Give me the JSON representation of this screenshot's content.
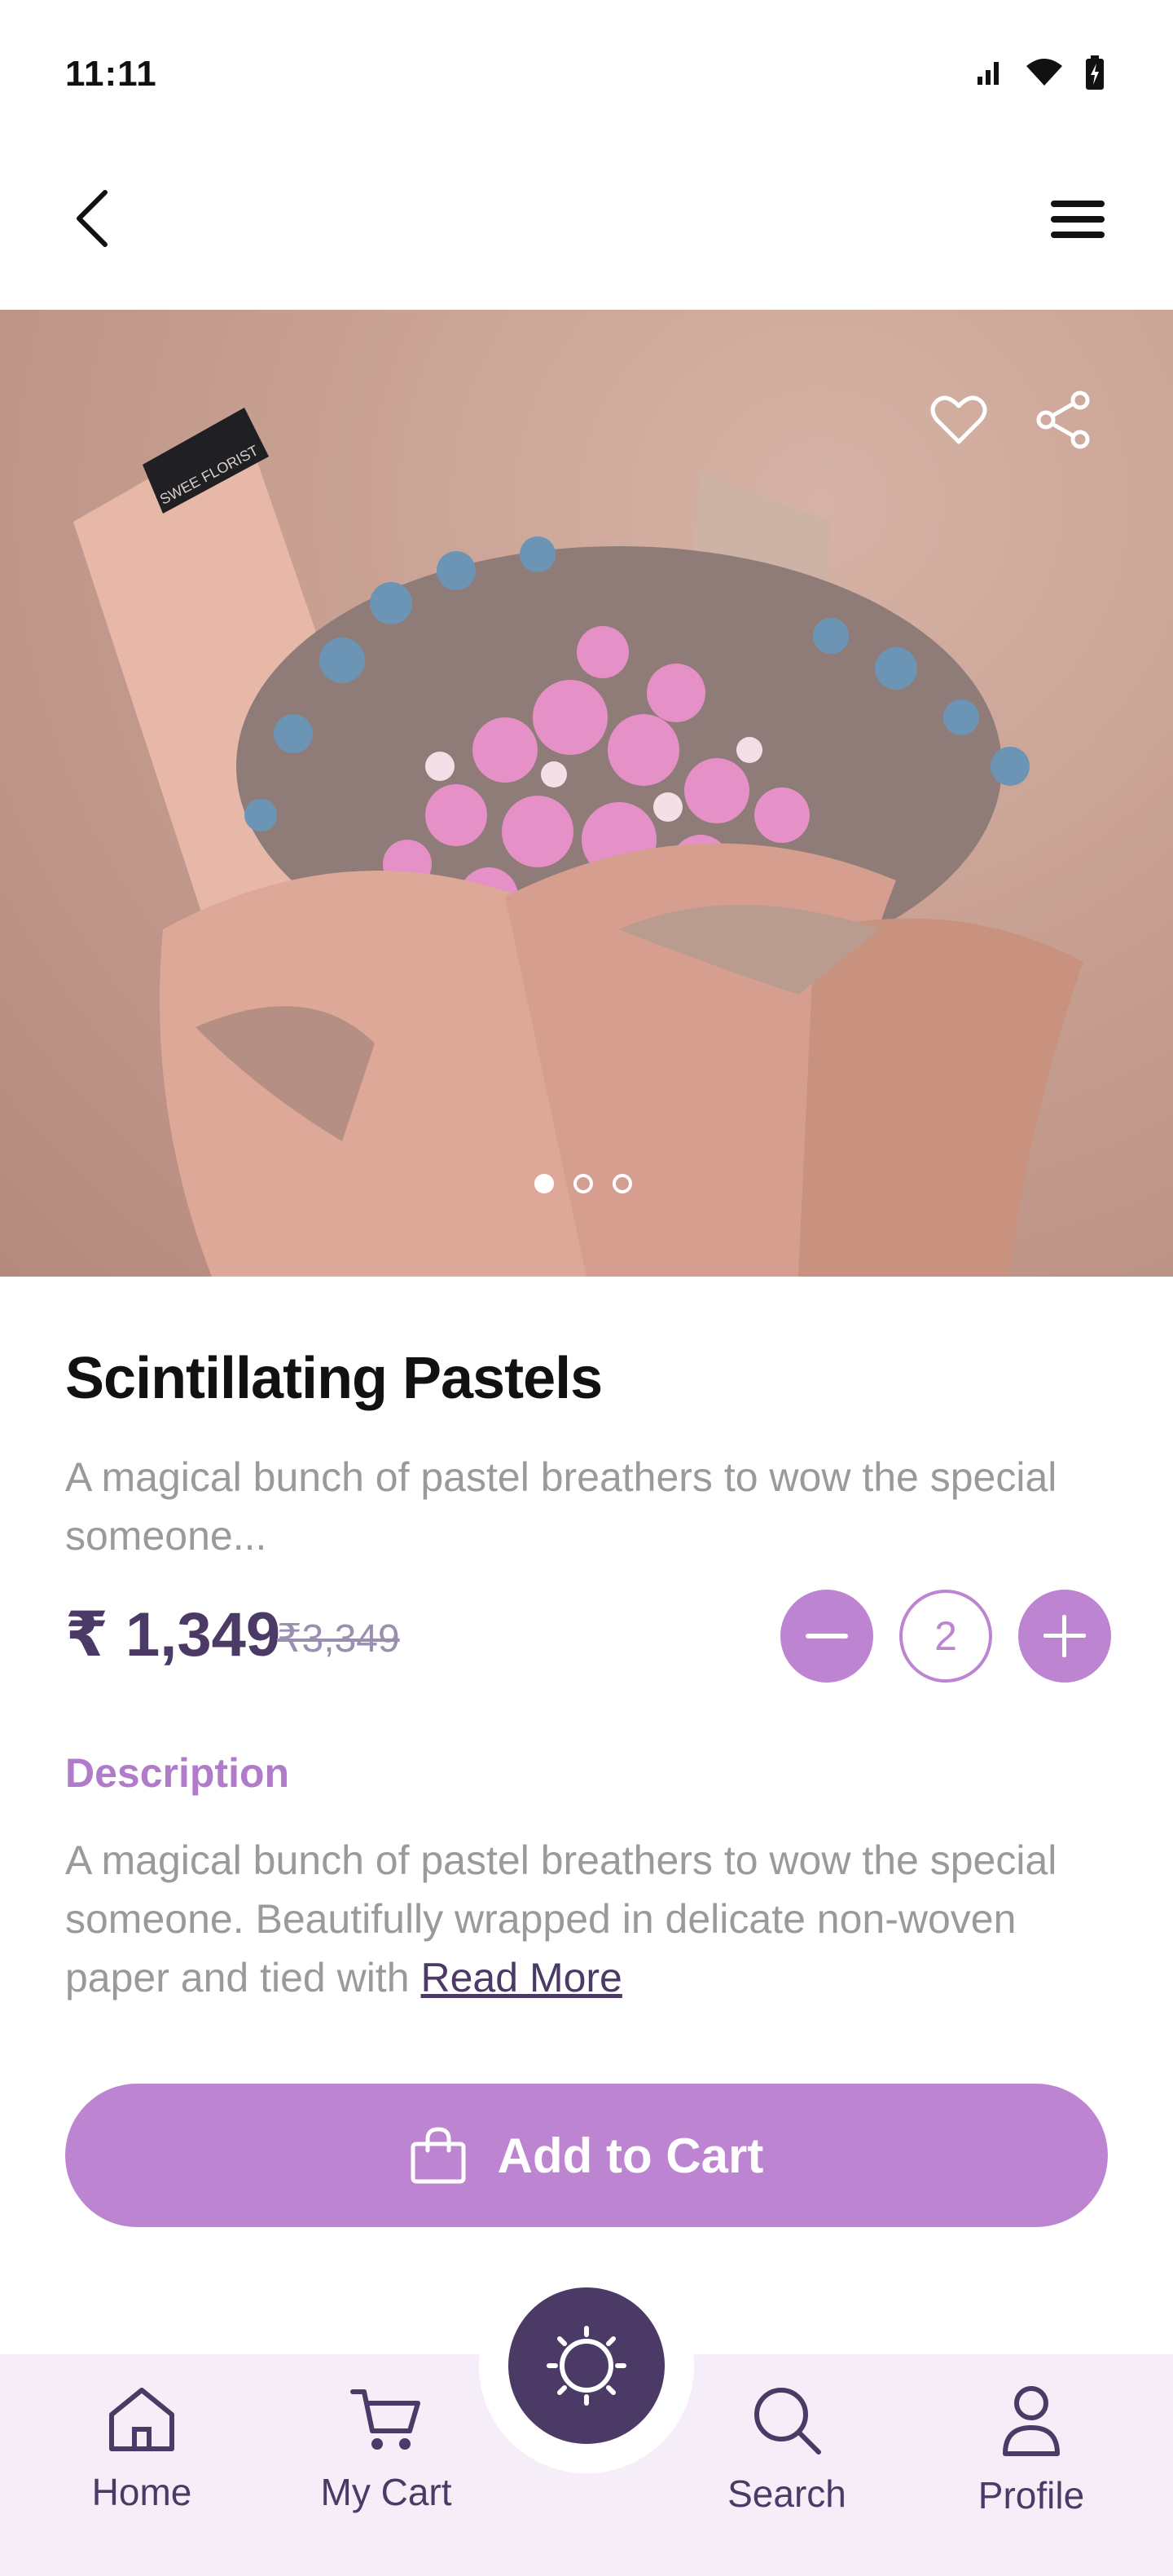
{
  "status_bar": {
    "time": "11:11",
    "icons": [
      "signal-icon",
      "wifi-icon",
      "battery-charging-icon"
    ]
  },
  "top_nav": {
    "back_icon": "chevron-left-icon",
    "menu_icon": "hamburger-menu-icon"
  },
  "hero": {
    "image_label": "SWEE FLORIST",
    "actions": [
      "heart-icon",
      "share-icon"
    ],
    "carousel": {
      "count": 3,
      "active_index": 0
    }
  },
  "product": {
    "title": "Scintillating Pastels",
    "subtitle": "A magical bunch of pastel breathers to wow the special someone...",
    "price": "₹ 1,349",
    "old_price": "₹3,349",
    "quantity": "2"
  },
  "description": {
    "heading": "Description",
    "body": "A magical bunch of pastel breathers to wow the special someone. Beautifully wrapped in delicate non-woven paper and tied with",
    "read_more": "Read More"
  },
  "cta": {
    "label": "Add to Cart",
    "icon": "shopping-bag-icon"
  },
  "bottom_nav": {
    "items": [
      {
        "label": "Home",
        "icon": "home-icon"
      },
      {
        "label": "My Cart",
        "icon": "cart-icon"
      },
      {
        "label": "Search",
        "icon": "search-icon"
      },
      {
        "label": "Profile",
        "icon": "profile-icon"
      }
    ],
    "center_icon": "sun-icon"
  },
  "colors": {
    "accent": "#bd84d1",
    "primary_dark": "#4b3a66",
    "muted_text": "#9a9a9a",
    "nav_bg": "#f5eef8"
  }
}
